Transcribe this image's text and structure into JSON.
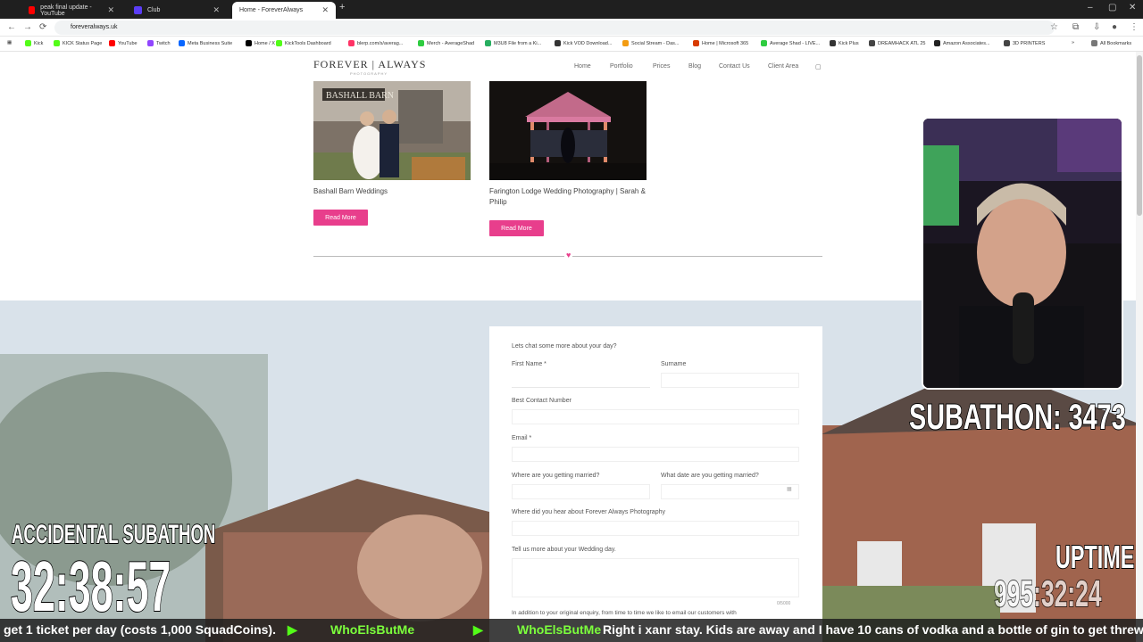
{
  "browser": {
    "tabs": [
      {
        "label": "peak final update - YouTube",
        "color": "#ff0000"
      },
      {
        "label": "Club",
        "color": "#5b3df5"
      },
      {
        "label": "Home - ForeverAlways",
        "color": "#888888"
      }
    ],
    "url": "foreveralways.uk",
    "bookmarks": [
      {
        "label": "Kick",
        "color": "#53fc18"
      },
      {
        "label": "KICK Status Page",
        "color": "#53fc18"
      },
      {
        "label": "YouTube",
        "color": "#ff0000"
      },
      {
        "label": "Twitch",
        "color": "#9146ff"
      },
      {
        "label": "Meta Business Suite",
        "color": "#0866ff"
      },
      {
        "label": "Home / X",
        "color": "#000000"
      },
      {
        "label": "KickTools Dashboard",
        "color": "#53fc18"
      },
      {
        "label": "blerp.com/s/averag...",
        "color": "#ff3366"
      },
      {
        "label": "Merch - AverageShad",
        "color": "#2ecc40"
      },
      {
        "label": "M3U8 File from a Ki...",
        "color": "#27ae60"
      },
      {
        "label": "Kick VOD Download...",
        "color": "#333333"
      },
      {
        "label": "Social Stream - Das...",
        "color": "#f39c12"
      },
      {
        "label": "Home | Microsoft 365",
        "color": "#d83b01"
      },
      {
        "label": "Average Shad - LIVE...",
        "color": "#2ecc40"
      },
      {
        "label": "Kick Plus",
        "color": "#333333"
      },
      {
        "label": "DREAMHACK ATL 25",
        "color": "#444444"
      },
      {
        "label": "Amazon Associates...",
        "color": "#222222"
      },
      {
        "label": "3D PRINTERS",
        "color": "#444444"
      }
    ],
    "all_bookmarks": "All Bookmarks"
  },
  "site": {
    "logo": "FOREVER | ALWAYS",
    "logo_sub": "PHOTOGRAPHY",
    "nav": [
      "Home",
      "Portfolio",
      "Prices",
      "Blog",
      "Contact Us",
      "Client Area"
    ],
    "accent": "#e83e8c",
    "cards": [
      {
        "title": "Bashall Barn Weddings",
        "button": "Read More"
      },
      {
        "title": "Farington Lodge Wedding Photography | Sarah & Philip",
        "button": "Read More"
      }
    ],
    "form": {
      "intro": "Lets chat some more about your day?",
      "first_name": "First Name *",
      "surname": "Surname",
      "contact": "Best Contact Number",
      "email": "Email *",
      "where": "Where are you getting married?",
      "when": "What date are you getting married?",
      "hear": "Where did you hear about Forever Always Photography",
      "tell": "Tell us more about your Wedding day.",
      "counter": "0/5000",
      "footer": "In addition to your original enquiry, from time to time we like to email our customers with"
    }
  },
  "overlay": {
    "subathon": "SUBATHON: 3473",
    "accidental": "ACCIDENTAL SUBATHON",
    "timer": "32:38:57",
    "uptime_label": "UPTIME",
    "uptime": "995:32:24",
    "ticker": {
      "left_text": "get 1 ticket per day (costs 1,000 SquadCoins).",
      "name1": "WhoElsButMe",
      "name2": "WhoElsButMe",
      "message": "Right i xanr stay. Kids are away and I have 10 cans of vodka and a bottle of gin to get threw"
    }
  }
}
